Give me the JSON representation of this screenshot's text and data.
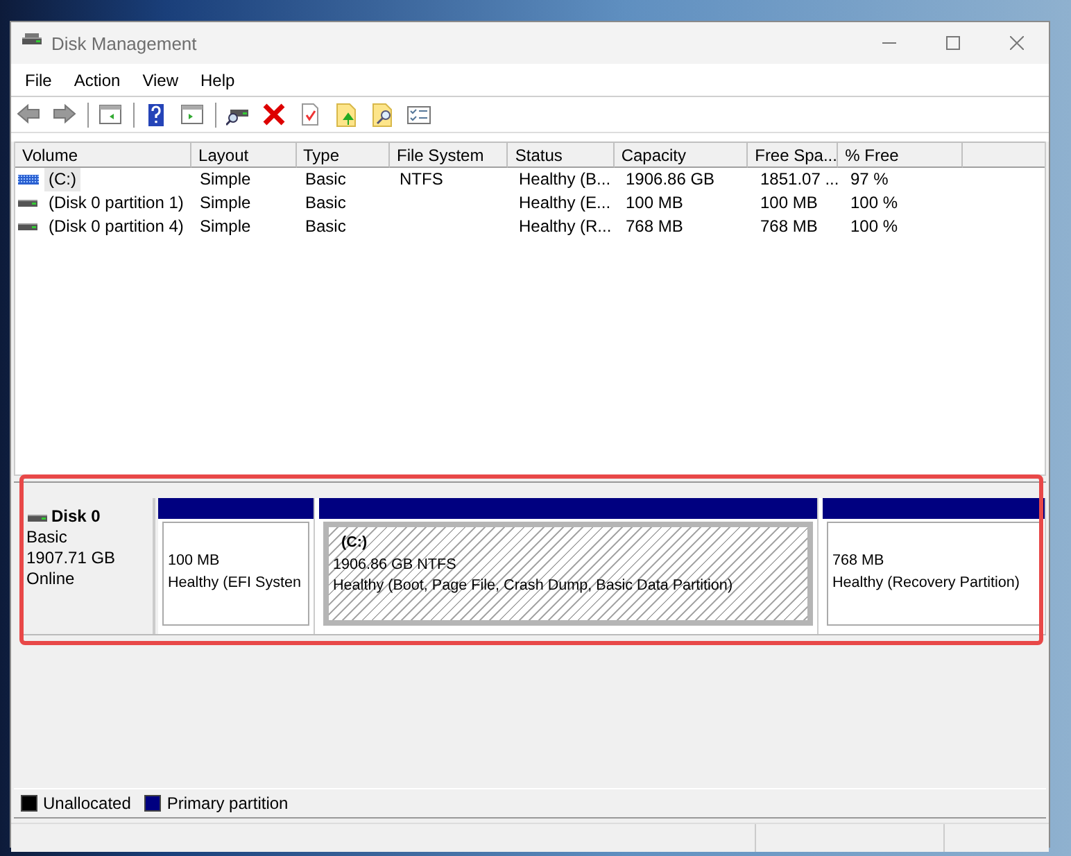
{
  "window": {
    "title": "Disk Management"
  },
  "menu": [
    {
      "label": "File"
    },
    {
      "label": "Action"
    },
    {
      "label": "View"
    },
    {
      "label": "Help"
    }
  ],
  "volume_table": {
    "columns": [
      "Volume",
      "Layout",
      "Type",
      "File System",
      "Status",
      "Capacity",
      "Free Spa...",
      "% Free"
    ],
    "rows": [
      {
        "kind": "volume",
        "selected": true,
        "cells": [
          "(C:)",
          "Simple",
          "Basic",
          "NTFS",
          "Healthy (B...",
          "1906.86 GB",
          "1851.07 ...",
          "97 %"
        ]
      },
      {
        "kind": "partition",
        "selected": false,
        "cells": [
          "(Disk 0 partition 1)",
          "Simple",
          "Basic",
          "",
          "Healthy (E...",
          "100 MB",
          "100 MB",
          "100 %"
        ]
      },
      {
        "kind": "partition",
        "selected": false,
        "cells": [
          "(Disk 0 partition 4)",
          "Simple",
          "Basic",
          "",
          "Healthy (R...",
          "768 MB",
          "768 MB",
          "100 %"
        ]
      }
    ]
  },
  "disk": {
    "name": "Disk 0",
    "type": "Basic",
    "size": "1907.71 GB",
    "status": "Online",
    "partitions": [
      {
        "kind": "primary",
        "selected": false,
        "size": "100 MB",
        "status": "Healthy (EFI Systen"
      },
      {
        "kind": "primary",
        "selected": true,
        "label": "(C:)",
        "size": "1906.86 GB NTFS",
        "status": "Healthy (Boot, Page File, Crash Dump, Basic Data Partition)"
      },
      {
        "kind": "primary",
        "selected": false,
        "size": "768 MB",
        "status": "Healthy (Recovery Partition)"
      }
    ]
  },
  "legend": [
    {
      "label": "Unallocated",
      "color": "#000000"
    },
    {
      "label": "Primary partition",
      "color": "#000080"
    }
  ]
}
